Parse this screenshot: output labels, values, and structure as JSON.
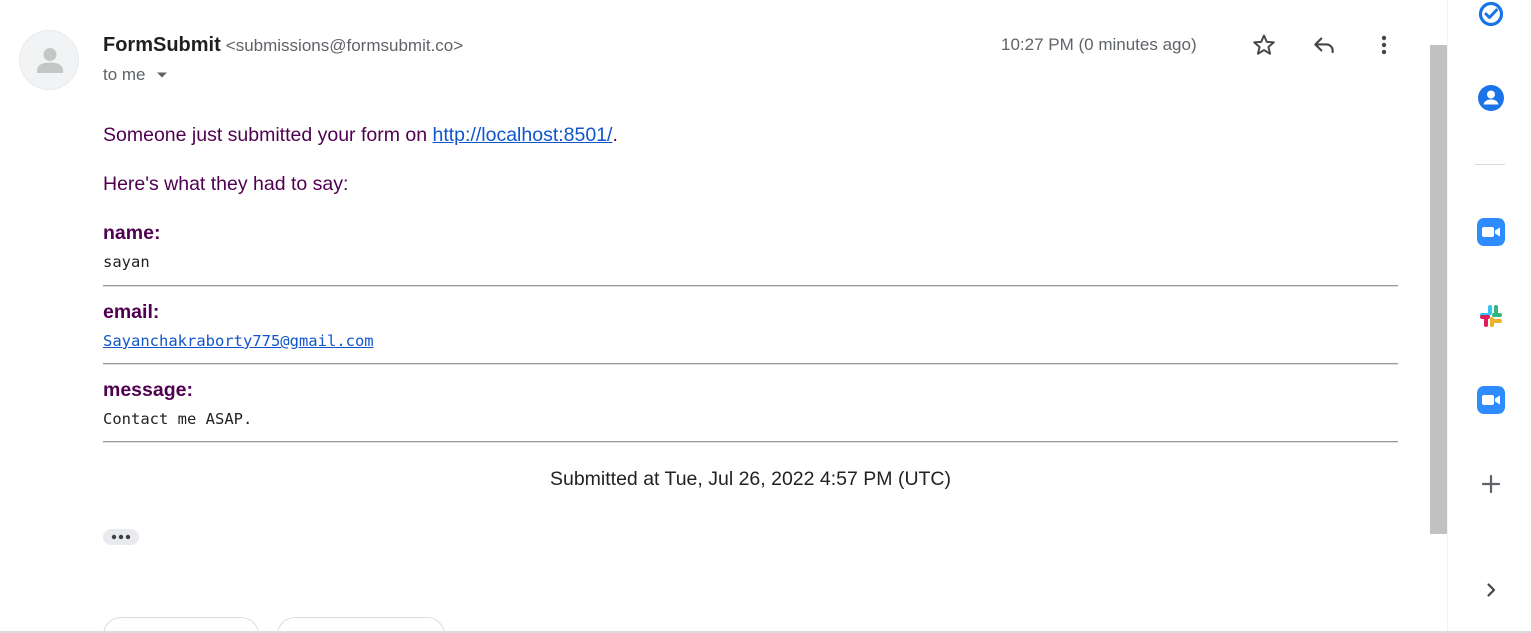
{
  "email": {
    "sender_name": "FormSubmit",
    "sender_email": "<submissions@formsubmit.co>",
    "recipient_label": "to me",
    "time": "10:27 PM (0 minutes ago)",
    "icons": {
      "avatar": "person-avatar-icon",
      "recipient_caret": "caret-down-icon",
      "star": "star-outline-icon",
      "reply": "reply-icon",
      "more": "more-vertical-icon"
    }
  },
  "message": {
    "intro_prefix": "Someone just submitted your form on ",
    "intro_link": "http://localhost:8501/",
    "intro_suffix": ".",
    "lead": "Here's what they had to say:",
    "fields": [
      {
        "label": "name:",
        "value": "sayan"
      },
      {
        "label": "email:",
        "value": "Sayanchakraborty775@gmail.com"
      },
      {
        "label": "message:",
        "value": "Contact me ASAP."
      }
    ],
    "submitted": "Submitted at Tue, Jul 26, 2022 4:57 PM (UTC)",
    "show_trimmed_icon": "ellipsis-icon"
  },
  "side_panel": {
    "items": [
      {
        "name": "tasks-icon",
        "color": "#1a73e8"
      },
      {
        "name": "contacts-icon",
        "color": "#1a73e8"
      },
      {
        "name": "zoom-icon",
        "color": "#2d8cff"
      },
      {
        "name": "slack-icon",
        "colors": [
          "#36c5f0",
          "#2eb67d",
          "#ecb22e",
          "#e01e5a"
        ]
      },
      {
        "name": "zoom-icon",
        "color": "#2d8cff"
      },
      {
        "name": "add-icon",
        "color": "#5f6368"
      },
      {
        "name": "chevron-right-icon",
        "color": "#5f6368"
      }
    ]
  },
  "colors": {
    "body_text": "#500050",
    "link": "#1155cc",
    "muted": "#5f6368",
    "scrollbar_thumb": "#c1c1c1"
  }
}
